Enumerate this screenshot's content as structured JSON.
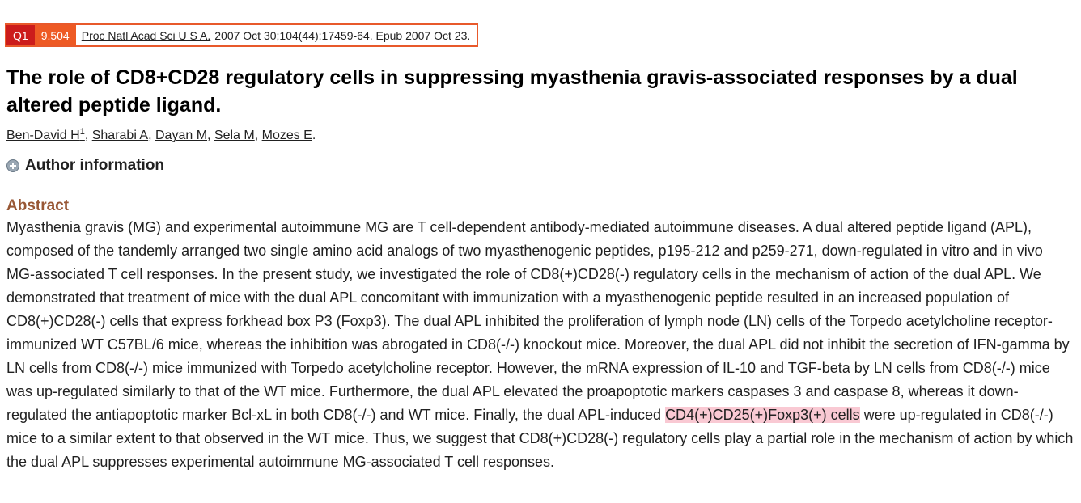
{
  "citation": {
    "quartile": "Q1",
    "impact_factor": "9.504",
    "journal": "Proc Natl Acad Sci U S A.",
    "details": "2007 Oct 30;104(44):17459-64. Epub 2007 Oct 23."
  },
  "title": "The role of CD8+CD28 regulatory cells in suppressing myasthenia gravis-associated responses by a dual altered peptide ligand.",
  "authors": [
    {
      "name": "Ben-David H",
      "sup": "1"
    },
    {
      "name": "Sharabi A"
    },
    {
      "name": "Dayan M"
    },
    {
      "name": "Sela M"
    },
    {
      "name": "Mozes E"
    }
  ],
  "author_info_label": "Author information",
  "abstract": {
    "heading": "Abstract",
    "text_before": "Myasthenia gravis (MG) and experimental autoimmune MG are T cell-dependent antibody-mediated autoimmune diseases. A dual altered peptide ligand (APL), composed of the tandemly arranged two single amino acid analogs of two myasthenogenic peptides, p195-212 and p259-271, down-regulated in vitro and in vivo MG-associated T cell responses. In the present study, we investigated the role of CD8(+)CD28(-) regulatory cells in the mechanism of action of the dual APL. We demonstrated that treatment of mice with the dual APL concomitant with immunization with a myasthenogenic peptide resulted in an increased population of CD8(+)CD28(-) cells that express forkhead box P3 (Foxp3). The dual APL inhibited the proliferation of lymph node (LN) cells of the Torpedo acetylcholine receptor-immunized WT C57BL/6 mice, whereas the inhibition was abrogated in CD8(-/-) knockout mice. Moreover, the dual APL did not inhibit the secretion of IFN-gamma by LN cells from CD8(-/-) mice immunized with Torpedo acetylcholine receptor. However, the mRNA expression of IL-10 and TGF-beta by LN cells from CD8(-/-) mice was up-regulated similarly to that of the WT mice. Furthermore, the dual APL elevated the proapoptotic markers caspases 3 and caspase 8, whereas it down-regulated the antiapoptotic marker Bcl-xL in both CD8(-/-) and WT mice. Finally, the dual APL-induced ",
    "highlight": "CD4(+)CD25(+)Foxp3(+) cells",
    "text_after": " were up-regulated in CD8(-/-) mice to a similar extent to that observed in the WT mice. Thus, we suggest that CD8(+)CD28(-) regulatory cells play a partial role in the mechanism of action by which the dual APL suppresses experimental autoimmune MG-associated T cell responses."
  },
  "colors": {
    "quartile_badge": "#cc1c1c",
    "impact_badge": "#ee5a24",
    "citation_border": "#e8592b",
    "abstract_heading": "#985735",
    "highlight": "#f9c9d3"
  }
}
